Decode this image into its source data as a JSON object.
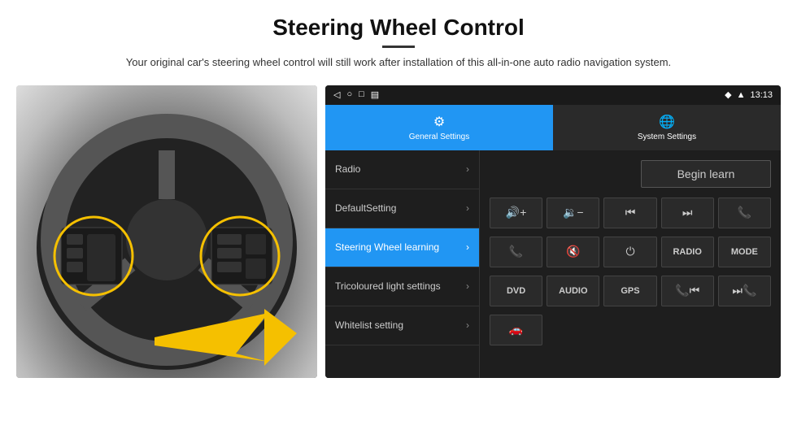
{
  "header": {
    "title": "Steering Wheel Control",
    "description": "Your original car's steering wheel control will still work after installation of this all-in-one auto radio navigation system."
  },
  "status_bar": {
    "time": "13:13",
    "icons": [
      "◁",
      "○",
      "□",
      "▤"
    ]
  },
  "tabs": [
    {
      "label": "General Settings",
      "active": true
    },
    {
      "label": "System Settings",
      "active": false
    }
  ],
  "menu_items": [
    {
      "label": "Radio",
      "active": false
    },
    {
      "label": "DefaultSetting",
      "active": false
    },
    {
      "label": "Steering Wheel learning",
      "active": true
    },
    {
      "label": "Tricoloured light settings",
      "active": false
    },
    {
      "label": "Whitelist setting",
      "active": false
    }
  ],
  "begin_learn": "Begin learn",
  "control_buttons_row1": [
    {
      "icon": "🔊+",
      "type": "icon"
    },
    {
      "icon": "🔉-",
      "type": "icon"
    },
    {
      "icon": "⏮",
      "type": "icon"
    },
    {
      "icon": "⏭",
      "type": "icon"
    },
    {
      "icon": "📞",
      "type": "icon"
    }
  ],
  "control_buttons_row2": [
    {
      "icon": "📞↙",
      "type": "icon"
    },
    {
      "icon": "🔇×",
      "type": "icon"
    },
    {
      "icon": "⏻",
      "type": "icon"
    },
    {
      "label": "RADIO",
      "type": "text"
    },
    {
      "label": "MODE",
      "type": "text"
    }
  ],
  "control_buttons_row3": [
    {
      "label": "DVD",
      "type": "text"
    },
    {
      "label": "AUDIO",
      "type": "text"
    },
    {
      "label": "GPS",
      "type": "text"
    },
    {
      "icon": "📞⏮",
      "type": "icon"
    },
    {
      "icon": "⏭📞",
      "type": "icon"
    }
  ],
  "bottom_row": [
    {
      "icon": "🚗",
      "type": "icon"
    }
  ]
}
